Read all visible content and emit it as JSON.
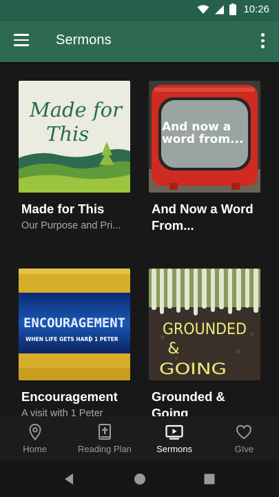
{
  "status_bar": {
    "time": "10:26"
  },
  "app_bar": {
    "title": "Sermons"
  },
  "cards": [
    {
      "title": "Made for This",
      "subtitle": "Our Purpose and Pri...",
      "art_text_line1": "Made for",
      "art_text_line2": "This"
    },
    {
      "title": "And Now a Word From...",
      "subtitle": "",
      "art_text_line1": "And now a",
      "art_text_line2": "word from..."
    },
    {
      "title": "Encouragement",
      "subtitle": "A visit with 1 Peter",
      "art_text_main": "ENCOURAGEMENT",
      "art_text_left": "WHEN LIFE GETS HARD",
      "art_text_right": "1 PETER"
    },
    {
      "title": "Grounded & Going",
      "subtitle": "",
      "art_text_line1": "GROUNDED",
      "art_text_line2": "&",
      "art_text_line3": "GOING"
    }
  ],
  "bottom_nav": {
    "items": [
      {
        "label": "Home",
        "icon": "location-pin-icon"
      },
      {
        "label": "Reading Plan",
        "icon": "bible-icon"
      },
      {
        "label": "Sermons",
        "icon": "tv-play-icon"
      },
      {
        "label": "GIve",
        "icon": "heart-icon"
      }
    ],
    "active": "Sermons"
  },
  "colors": {
    "app_bar": "#2e6a52",
    "status_bar": "#26604a",
    "background": "#181818",
    "subtitle_text": "#a9a9a9"
  }
}
